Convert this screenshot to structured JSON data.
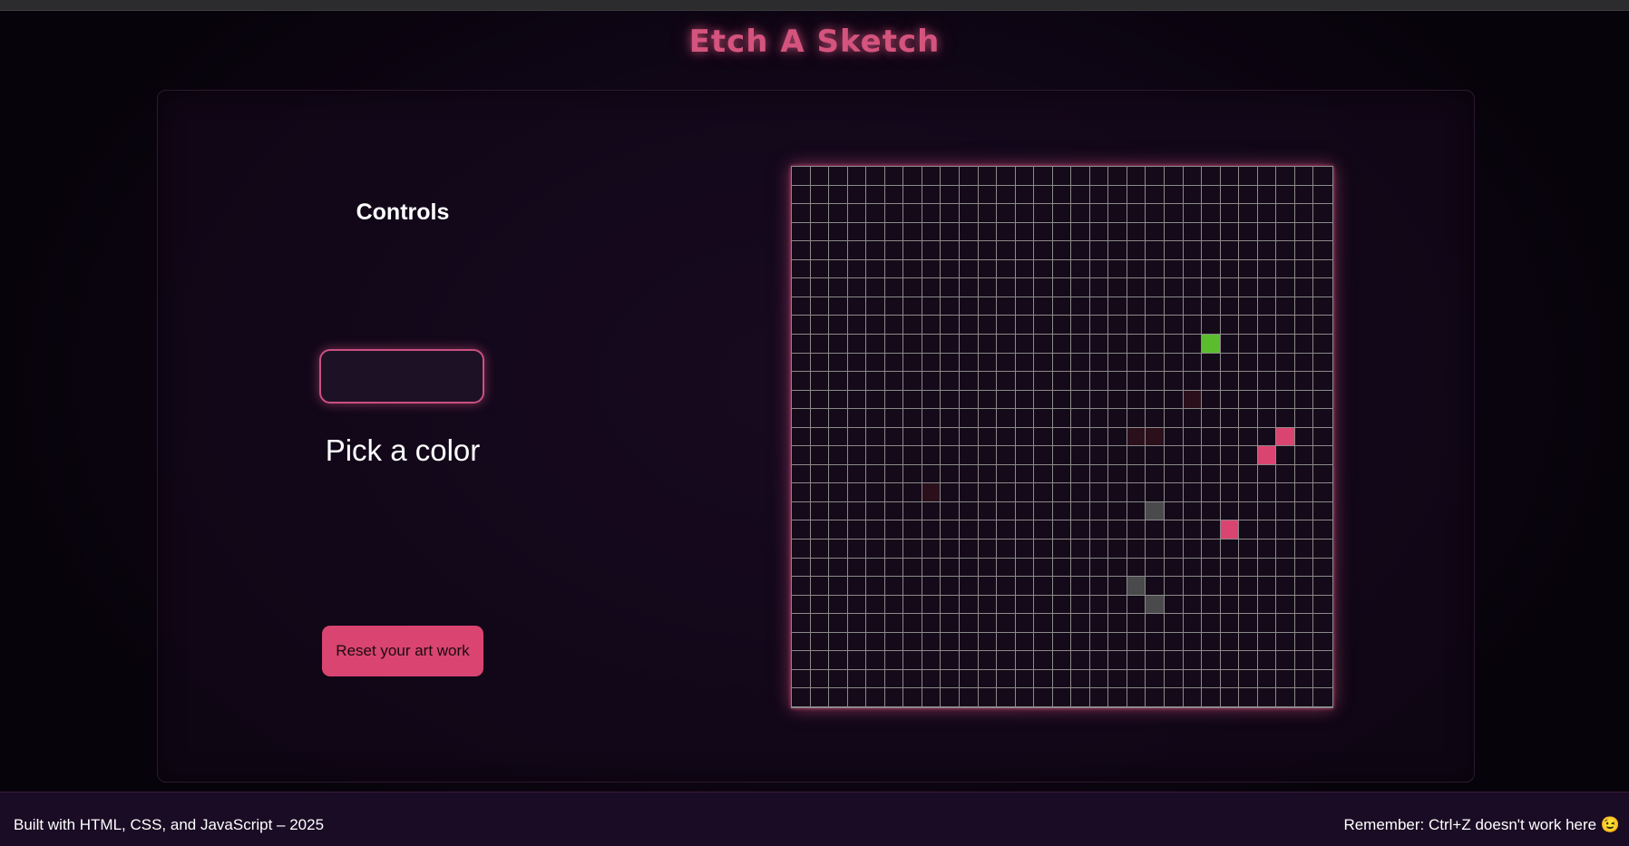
{
  "header": {
    "title": "Etch A Sketch"
  },
  "controls": {
    "title": "Controls",
    "pick_label": "Pick a color",
    "reset_label": "Reset your art work"
  },
  "grid": {
    "rows": 29,
    "cols": 29,
    "default_color": "#150a19",
    "line_color": "#8a8a8a",
    "painted_cells": [
      {
        "row": 9,
        "col": 22,
        "color": "#5bbd2e"
      },
      {
        "row": 12,
        "col": 21,
        "color": "#2b0f1a"
      },
      {
        "row": 14,
        "col": 18,
        "color": "#2b0f1a"
      },
      {
        "row": 14,
        "col": 19,
        "color": "#2b0f1a"
      },
      {
        "row": 14,
        "col": 26,
        "color": "#da4471"
      },
      {
        "row": 15,
        "col": 25,
        "color": "#da4471"
      },
      {
        "row": 17,
        "col": 7,
        "color": "#2b0f1a"
      },
      {
        "row": 18,
        "col": 19,
        "color": "#4a4a4c"
      },
      {
        "row": 19,
        "col": 23,
        "color": "#da4471"
      },
      {
        "row": 22,
        "col": 18,
        "color": "#4a4a4c"
      },
      {
        "row": 23,
        "col": 19,
        "color": "#4a4a4c"
      }
    ]
  },
  "footer": {
    "left_text": "Built with HTML, CSS, and JavaScript – 2025",
    "right_text": "Remember: Ctrl+Z doesn't work here 😉"
  },
  "colors": {
    "accent": "#da4471",
    "title_glow": "#d4547e",
    "background": "#12071a"
  }
}
